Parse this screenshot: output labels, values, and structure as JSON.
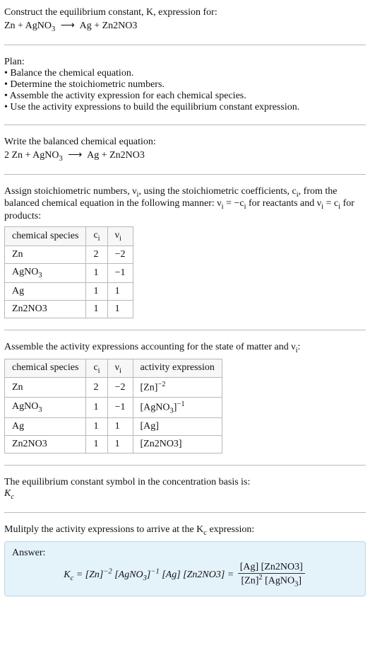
{
  "title_line": "Construct the equilibrium constant, K, expression for:",
  "unbalanced_eq": {
    "lhs": "Zn + AgNO<sub>3</sub>",
    "arrow": "⟶",
    "rhs": "Ag + Zn2NO3"
  },
  "plan": {
    "header": "Plan:",
    "items": [
      "• Balance the chemical equation.",
      "• Determine the stoichiometric numbers.",
      "• Assemble the activity expression for each chemical species.",
      "• Use the activity expressions to build the equilibrium constant expression."
    ]
  },
  "balanced_header": "Write the balanced chemical equation:",
  "balanced_eq": {
    "lhs": "2 Zn + AgNO<sub>3</sub>",
    "arrow": "⟶",
    "rhs": "Ag + Zn2NO3"
  },
  "assign_text": "Assign stoichiometric numbers, ν<sub>i</sub>, using the stoichiometric coefficients, c<sub>i</sub>, from the balanced chemical equation in the following manner: ν<sub>i</sub> = −c<sub>i</sub> for reactants and ν<sub>i</sub> = c<sub>i</sub> for products:",
  "table1": {
    "headers": [
      "chemical species",
      "c<sub>i</sub>",
      "ν<sub>i</sub>"
    ],
    "rows": [
      [
        "Zn",
        "2",
        "−2"
      ],
      [
        "AgNO<sub>3</sub>",
        "1",
        "−1"
      ],
      [
        "Ag",
        "1",
        "1"
      ],
      [
        "Zn2NO3",
        "1",
        "1"
      ]
    ]
  },
  "assemble_text": "Assemble the activity expressions accounting for the state of matter and ν<sub>i</sub>:",
  "table2": {
    "headers": [
      "chemical species",
      "c<sub>i</sub>",
      "ν<sub>i</sub>",
      "activity expression"
    ],
    "rows": [
      [
        "Zn",
        "2",
        "−2",
        "[Zn]<sup>−2</sup>"
      ],
      [
        "AgNO<sub>3</sub>",
        "1",
        "−1",
        "[AgNO<sub>3</sub>]<sup>−1</sup>"
      ],
      [
        "Ag",
        "1",
        "1",
        "[Ag]"
      ],
      [
        "Zn2NO3",
        "1",
        "1",
        "[Zn2NO3]"
      ]
    ]
  },
  "basis_text": "The equilibrium constant symbol in the concentration basis is:",
  "kc_symbol": "K<sub>c</sub>",
  "multiply_text": "Mulitply the activity expressions to arrive at the K<sub>c</sub> expression:",
  "answer": {
    "label": "Answer:",
    "left": "K<sub>c</sub> = [Zn]<sup>−2</sup> [AgNO<sub>3</sub>]<sup>−1</sup> [Ag] [Zn2NO3] =",
    "frac_num": "[Ag] [Zn2NO3]",
    "frac_den": "[Zn]<sup>2</sup> [AgNO<sub>3</sub>]"
  },
  "chart_data": {
    "type": "table",
    "tables": [
      {
        "title": "stoichiometric numbers",
        "columns": [
          "chemical species",
          "c_i",
          "nu_i"
        ],
        "rows": [
          {
            "chemical species": "Zn",
            "c_i": 2,
            "nu_i": -2
          },
          {
            "chemical species": "AgNO3",
            "c_i": 1,
            "nu_i": -1
          },
          {
            "chemical species": "Ag",
            "c_i": 1,
            "nu_i": 1
          },
          {
            "chemical species": "Zn2NO3",
            "c_i": 1,
            "nu_i": 1
          }
        ]
      },
      {
        "title": "activity expressions",
        "columns": [
          "chemical species",
          "c_i",
          "nu_i",
          "activity expression"
        ],
        "rows": [
          {
            "chemical species": "Zn",
            "c_i": 2,
            "nu_i": -2,
            "activity expression": "[Zn]^-2"
          },
          {
            "chemical species": "AgNO3",
            "c_i": 1,
            "nu_i": -1,
            "activity expression": "[AgNO3]^-1"
          },
          {
            "chemical species": "Ag",
            "c_i": 1,
            "nu_i": 1,
            "activity expression": "[Ag]"
          },
          {
            "chemical species": "Zn2NO3",
            "c_i": 1,
            "nu_i": 1,
            "activity expression": "[Zn2NO3]"
          }
        ]
      }
    ]
  }
}
